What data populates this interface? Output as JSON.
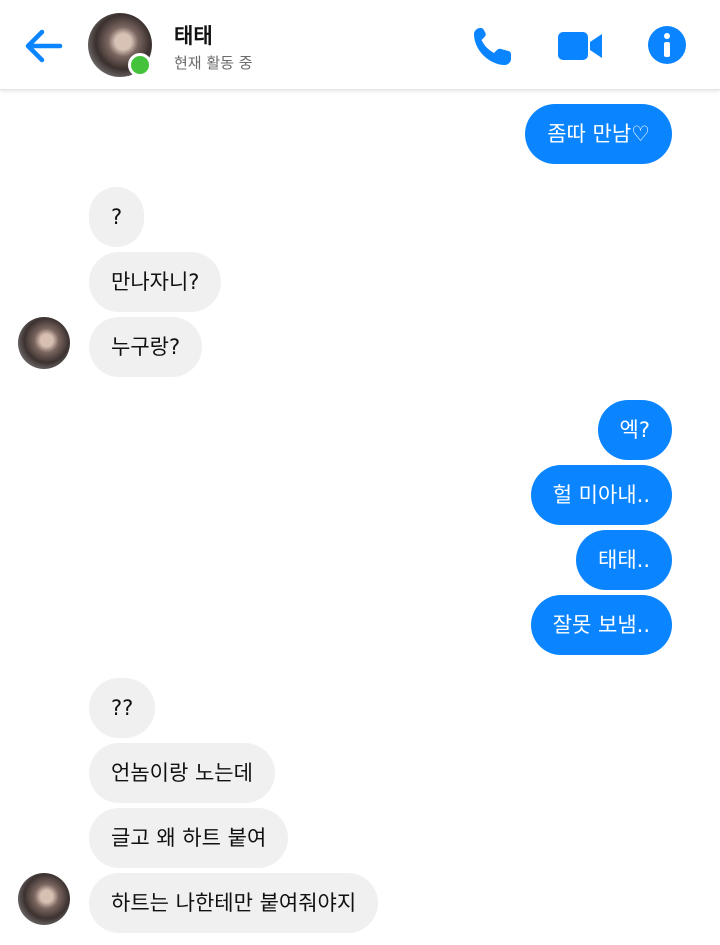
{
  "header": {
    "contact_name": "태태",
    "status": "현재 활동 중",
    "accent_color": "#0a84ff",
    "online_color": "#44c23b"
  },
  "messages": [
    {
      "from": "me",
      "text": "좀따 만남♡"
    },
    {
      "from": "them",
      "text": "?"
    },
    {
      "from": "them",
      "text": "만나자니?"
    },
    {
      "from": "them",
      "text": "누구랑?"
    },
    {
      "from": "me",
      "text": "엑?"
    },
    {
      "from": "me",
      "text": "헐 미아내.."
    },
    {
      "from": "me",
      "text": "태태.."
    },
    {
      "from": "me",
      "text": "잘못 보냄.."
    },
    {
      "from": "them",
      "text": "??"
    },
    {
      "from": "them",
      "text": "언놈이랑 노는데"
    },
    {
      "from": "them",
      "text": "글고 왜 하트 붙여"
    },
    {
      "from": "them",
      "text": "하트는 나한테만 붙여줘야지"
    }
  ]
}
